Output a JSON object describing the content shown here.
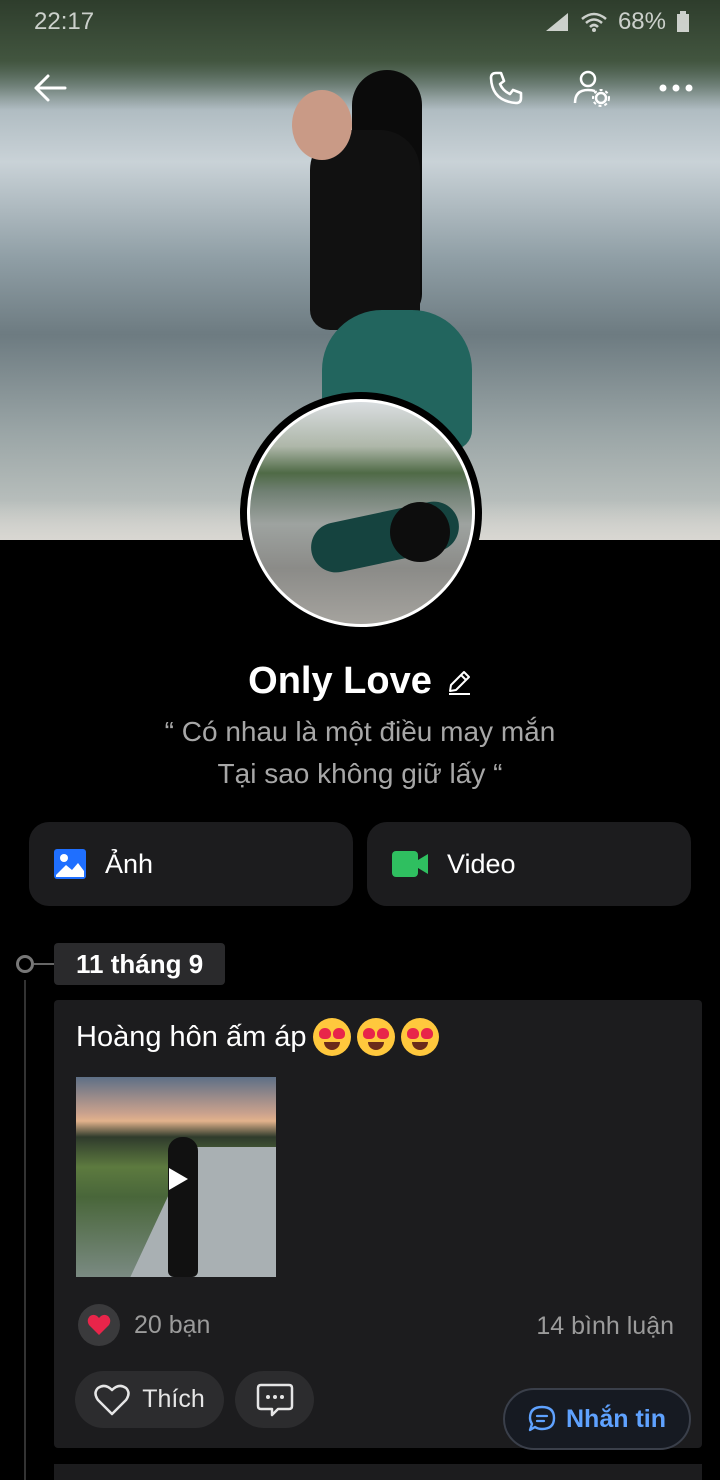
{
  "status_bar": {
    "time": "22:17",
    "battery": "68%"
  },
  "profile": {
    "name": "Only Love",
    "status_line_1": "“ Có nhau là một điều may mắn",
    "status_line_2": "Tại sao không giữ lấy “"
  },
  "media": {
    "photos_label": "Ảnh",
    "video_label": "Video"
  },
  "timeline": {
    "date": "11 tháng 9",
    "post": {
      "text": "Hoàng hôn ấm áp",
      "likes": "20 bạn",
      "comments": "14 bình luận",
      "like_label": "Thích"
    }
  },
  "message_button": {
    "label": "Nhắn tin"
  },
  "colors": {
    "background": "#000000",
    "card": "#1c1c1e",
    "accent_blue": "#5fa2ff",
    "photo_icon": "#1f6fff",
    "video_icon": "#2fbf60",
    "heart": "#e8254a"
  },
  "icons": {
    "back": "back-arrow-icon",
    "call": "phone-icon",
    "settings": "user-settings-icon",
    "more": "more-dots-icon",
    "edit": "pencil-icon",
    "photo": "image-icon",
    "video": "video-camera-icon",
    "like": "heart-outline-icon",
    "comment": "comment-bubble-icon",
    "message": "chat-bubble-icon"
  }
}
